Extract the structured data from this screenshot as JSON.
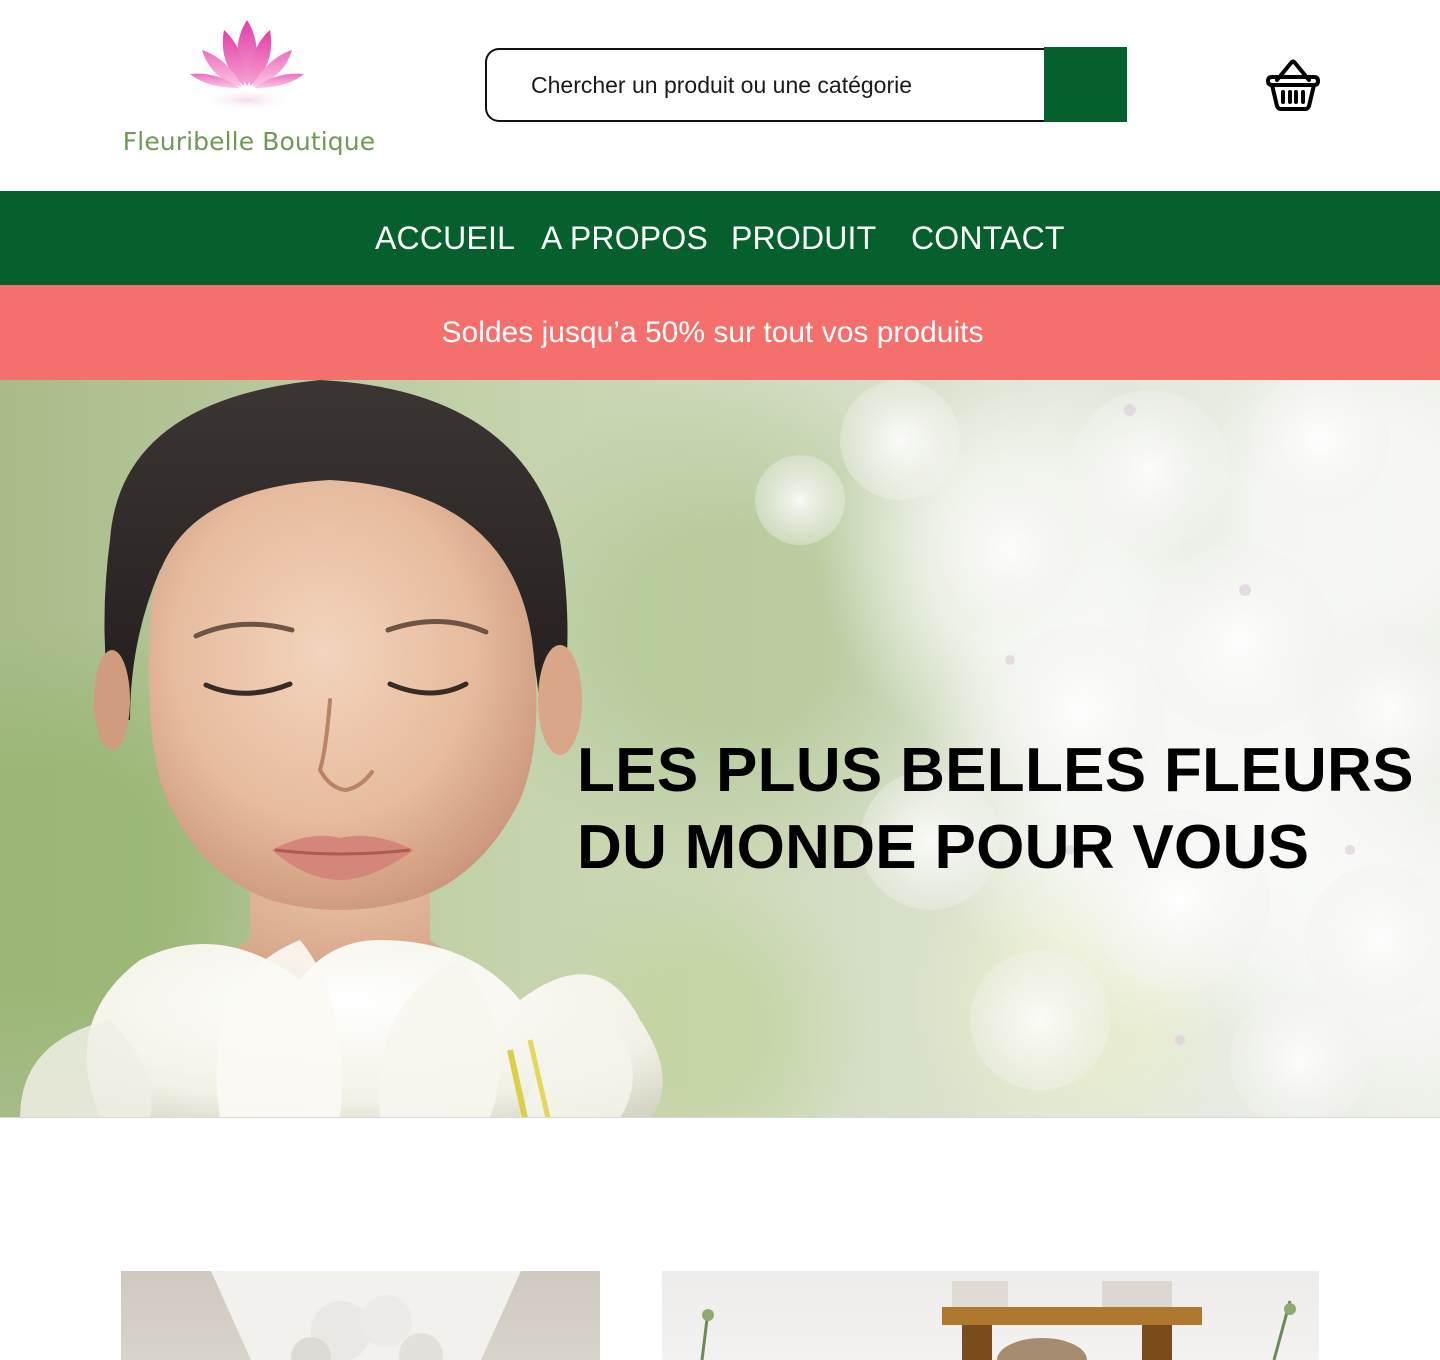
{
  "brand": {
    "name": "Fleuribelle Boutique",
    "accent_color": "#06602e",
    "promo_color": "#f56f6c",
    "logo_text_color": "#6f9a55",
    "logo_mark_colors": [
      "#e040a8",
      "#f7a7d3"
    ]
  },
  "search": {
    "placeholder": "Chercher un produit ou une catégorie"
  },
  "icons": {
    "cart": "shopping-basket-icon",
    "logo": "lotus-icon"
  },
  "nav": {
    "items": [
      {
        "label": "ACCUEIL"
      },
      {
        "label": "A PROPOS"
      },
      {
        "label": "PRODUIT"
      },
      {
        "label": "CONTACT"
      }
    ]
  },
  "promo": {
    "text": "Soldes jusqu’a 50% sur tout vos produits"
  },
  "hero": {
    "title_lines": [
      "LES PLUS BELLES FLEURS",
      "DU MONDE POUR VOUS"
    ]
  }
}
